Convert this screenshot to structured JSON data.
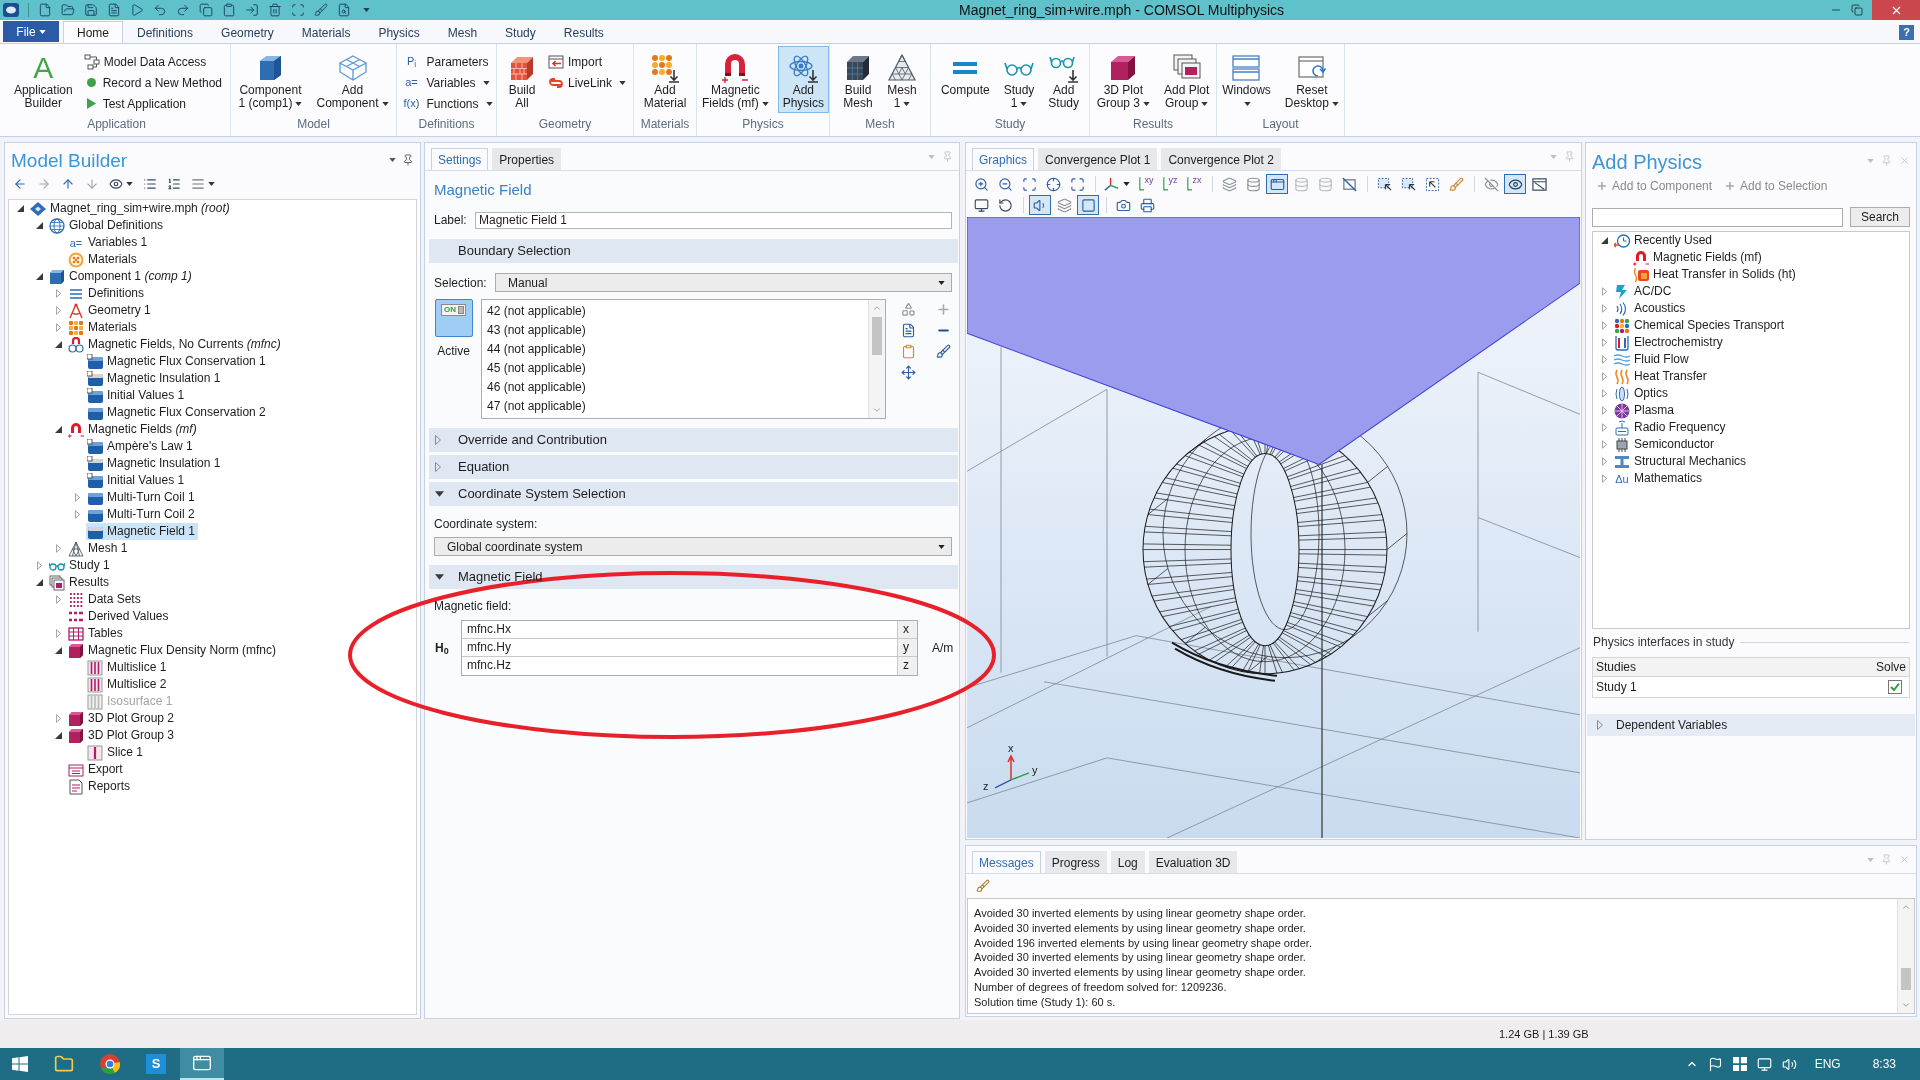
{
  "window": {
    "title": "Magnet_ring_sim+wire.mph - COMSOL Multiphysics"
  },
  "ribbon": {
    "file": "File",
    "help": "?",
    "tabs": [
      {
        "label": "Home",
        "selected": true
      },
      {
        "label": "Definitions",
        "selected": false
      },
      {
        "label": "Geometry",
        "selected": false
      },
      {
        "label": "Materials",
        "selected": false
      },
      {
        "label": "Physics",
        "selected": false
      },
      {
        "label": "Mesh",
        "selected": false
      },
      {
        "label": "Study",
        "selected": false
      },
      {
        "label": "Results",
        "selected": false
      }
    ],
    "groups": [
      {
        "title": "Application",
        "large": [
          {
            "kind": "builder",
            "glyph": "A",
            "lines": [
              "Application",
              "Builder"
            ],
            "dropdown": false,
            "on": false
          }
        ],
        "small": [
          {
            "kind": "data-access",
            "label": "Model Data Access",
            "dropdown": false
          },
          {
            "kind": "record",
            "label": "Record a New Method",
            "dropdown": false
          },
          {
            "kind": "run",
            "label": "Test Application",
            "dropdown": false
          }
        ]
      },
      {
        "title": "Model",
        "large": [
          {
            "kind": "component",
            "lines": [
              "Component",
              "1 (comp1)"
            ],
            "dropdown": true,
            "on": false
          },
          {
            "kind": "add-component",
            "lines": [
              "Add",
              "Component"
            ],
            "dropdown": true,
            "on": false
          }
        ]
      },
      {
        "title": "Definitions",
        "small": [
          {
            "kind": "glyph",
            "glyph": "P$_{i}$",
            "label": "Parameters",
            "dropdown": false
          },
          {
            "kind": "glyph",
            "glyph": "a=",
            "label": "Variables",
            "dropdown": true
          },
          {
            "kind": "glyph",
            "glyph": "f(x)",
            "label": "Functions",
            "dropdown": true
          }
        ]
      },
      {
        "title": "Geometry",
        "large": [
          {
            "kind": "build-all",
            "lines": [
              "Build",
              "All"
            ],
            "dropdown": false,
            "on": false
          }
        ],
        "small": [
          {
            "kind": "import",
            "label": "Import",
            "dropdown": false
          },
          {
            "kind": "livelink",
            "label": "LiveLink",
            "dropdown": true
          }
        ]
      },
      {
        "title": "Materials",
        "large": [
          {
            "kind": "add-material",
            "lines": [
              "Add",
              "Material"
            ],
            "dropdown": false,
            "on": false
          }
        ]
      },
      {
        "title": "Physics",
        "large": [
          {
            "kind": "magnet",
            "lines": [
              "Magnetic",
              "Fields (mf)"
            ],
            "dropdown": true,
            "on": false
          },
          {
            "kind": "add-physics",
            "lines": [
              "Add",
              "Physics"
            ],
            "dropdown": false,
            "on": true
          }
        ]
      },
      {
        "title": "Mesh",
        "large": [
          {
            "kind": "build-mesh",
            "lines": [
              "Build",
              "Mesh"
            ],
            "dropdown": false,
            "on": false
          },
          {
            "kind": "mesh",
            "lines": [
              "Mesh",
              "1"
            ],
            "dropdown": true,
            "on": false
          }
        ]
      },
      {
        "title": "Study",
        "large": [
          {
            "kind": "compute",
            "lines": [
              "Compute"
            ],
            "dropdown": false,
            "on": false
          },
          {
            "kind": "study",
            "lines": [
              "Study",
              "1"
            ],
            "dropdown": true,
            "on": false
          },
          {
            "kind": "add-study",
            "lines": [
              "Add",
              "Study"
            ],
            "dropdown": false,
            "on": false
          }
        ]
      },
      {
        "title": "Results",
        "large": [
          {
            "kind": "plot-group",
            "lines": [
              "3D Plot",
              "Group 3"
            ],
            "dropdown": true,
            "on": false
          },
          {
            "kind": "add-plot",
            "lines": [
              "Add Plot",
              "Group"
            ],
            "dropdown": true,
            "on": false
          }
        ]
      },
      {
        "title": "Layout",
        "large": [
          {
            "kind": "windows",
            "lines": [
              "Windows"
            ],
            "dropdown": true,
            "on": false
          },
          {
            "kind": "reset",
            "lines": [
              "Reset",
              "Desktop"
            ],
            "dropdown": true,
            "on": false
          }
        ]
      }
    ]
  },
  "model_builder": {
    "title": "Model Builder",
    "tree": [
      {
        "label": "Magnet_ring_sim+wire.mph *(root)*",
        "kind": "file",
        "expanded": true,
        "selected": false,
        "disabled": false,
        "children": [
          {
            "label": "Global Definitions",
            "kind": "globe",
            "expanded": true,
            "selected": false,
            "disabled": false,
            "children": [
              {
                "label": "Variables 1",
                "kind": "variables",
                "glyph": "a=",
                "selected": false,
                "disabled": false
              },
              {
                "label": "Materials",
                "kind": "materials-global",
                "selected": false,
                "disabled": false
              }
            ]
          },
          {
            "label": "Component 1 *(comp 1)*",
            "kind": "component",
            "expanded": true,
            "selected": false,
            "disabled": false,
            "children": [
              {
                "label": "Definitions",
                "kind": "definitions",
                "expanded": false,
                "selected": false,
                "disabled": false
              },
              {
                "label": "Geometry 1",
                "kind": "geometry",
                "expanded": false,
                "selected": false,
                "disabled": false
              },
              {
                "label": "Materials",
                "kind": "materials",
                "expanded": false,
                "selected": false,
                "disabled": false
              },
              {
                "label": "Magnetic Fields, No Currents *(mfnc)*",
                "kind": "mfnc",
                "expanded": true,
                "selected": false,
                "disabled": false,
                "children": [
                  {
                    "label": "Magnetic Flux Conservation 1",
                    "kind": "domain-default",
                    "selected": false,
                    "disabled": false
                  },
                  {
                    "label": "Magnetic Insulation 1",
                    "kind": "boundary-default",
                    "selected": false,
                    "disabled": false
                  },
                  {
                    "label": "Initial Values 1",
                    "kind": "domain-default",
                    "selected": false,
                    "disabled": false
                  },
                  {
                    "label": "Magnetic Flux Conservation 2",
                    "kind": "domain",
                    "selected": false,
                    "disabled": false
                  }
                ]
              },
              {
                "label": "Magnetic Fields *(mf)*",
                "kind": "magnet",
                "expanded": true,
                "selected": false,
                "disabled": false,
                "children": [
                  {
                    "label": "Ampère's Law 1",
                    "kind": "domain-default",
                    "selected": false,
                    "disabled": false
                  },
                  {
                    "label": "Magnetic Insulation 1",
                    "kind": "boundary-default",
                    "selected": false,
                    "disabled": false
                  },
                  {
                    "label": "Initial Values 1",
                    "kind": "domain-default",
                    "selected": false,
                    "disabled": false
                  },
                  {
                    "label": "Multi-Turn Coil 1",
                    "kind": "domain",
                    "expanded": false,
                    "selected": false,
                    "disabled": false
                  },
                  {
                    "label": "Multi-Turn Coil 2",
                    "kind": "domain",
                    "expanded": false,
                    "selected": false,
                    "disabled": false
                  },
                  {
                    "label": "Magnetic Field 1",
                    "kind": "boundary",
                    "selected": true,
                    "disabled": false
                  }
                ]
              },
              {
                "label": "Mesh 1",
                "kind": "mesh",
                "expanded": false,
                "selected": false,
                "disabled": false
              }
            ]
          },
          {
            "label": "Study 1",
            "kind": "study",
            "expanded": false,
            "selected": false,
            "disabled": false
          },
          {
            "label": "Results",
            "kind": "results",
            "expanded": true,
            "selected": false,
            "disabled": false,
            "children": [
              {
                "label": "Data Sets",
                "kind": "datasets",
                "expanded": false,
                "selected": false,
                "disabled": false
              },
              {
                "label": "Derived Values",
                "kind": "derived",
                "selected": false,
                "disabled": false
              },
              {
                "label": "Tables",
                "kind": "table",
                "expanded": false,
                "selected": false,
                "disabled": false
              },
              {
                "label": "Magnetic Flux Density Norm (mfnc)",
                "kind": "plotgroup",
                "expanded": true,
                "selected": false,
                "disabled": false,
                "children": [
                  {
                    "label": "Multislice 1",
                    "kind": "multislice",
                    "selected": false,
                    "disabled": false
                  },
                  {
                    "label": "Multislice 2",
                    "kind": "multislice",
                    "selected": false,
                    "disabled": false
                  },
                  {
                    "label": "Isosurface 1",
                    "kind": "multislice",
                    "selected": false,
                    "disabled": true
                  }
                ]
              },
              {
                "label": "3D Plot Group 2",
                "kind": "plotgroup",
                "expanded": false,
                "selected": false,
                "disabled": false
              },
              {
                "label": "3D Plot Group 3",
                "kind": "plotgroup",
                "expanded": true,
                "selected": false,
                "disabled": false,
                "children": [
                  {
                    "label": "Slice 1",
                    "kind": "slice",
                    "selected": false,
                    "disabled": false
                  }
                ]
              },
              {
                "label": "Export",
                "kind": "export",
                "selected": false,
                "disabled": false
              },
              {
                "label": "Reports",
                "kind": "reports",
                "selected": false,
                "disabled": false
              }
            ]
          }
        ]
      }
    ]
  },
  "settings": {
    "tabs": [
      {
        "label": "Settings",
        "selected": true
      },
      {
        "label": "Properties",
        "selected": false
      }
    ],
    "title": "Magnetic Field",
    "label": {
      "caption": "Label:",
      "value": "Magnetic Field 1"
    },
    "sections": [
      {
        "kind": "selection",
        "title": "Boundary Selection",
        "caption": "Selection:",
        "value": "Manual",
        "switch": "ON",
        "active_caption": "Active",
        "active": true,
        "items": [
          "42 (not applicable)",
          "43 (not applicable)",
          "44 (not applicable)",
          "45 (not applicable)",
          "46 (not applicable)",
          "47 (not applicable)"
        ]
      },
      {
        "title": "Override and Contribution",
        "expanded": false
      },
      {
        "title": "Equation",
        "expanded": false
      },
      {
        "kind": "coordinate",
        "title": "Coordinate System Selection",
        "expanded": true,
        "caption": "Coordinate system:",
        "value": "Global coordinate system"
      },
      {
        "kind": "vector",
        "title": "Magnetic Field",
        "expanded": true,
        "caption": "Magnetic field:",
        "symbol": "H$_{0}$",
        "unit": "A/m",
        "components": [
          {
            "value": "mfnc.Hx",
            "axis": "x"
          },
          {
            "value": "mfnc.Hy",
            "axis": "y"
          },
          {
            "value": "mfnc.Hz",
            "axis": "z"
          }
        ]
      }
    ]
  },
  "graphics": {
    "tabs": [
      {
        "label": "Graphics",
        "selected": true
      },
      {
        "label": "Convergence Plot 1",
        "selected": false
      },
      {
        "label": "Convergence Plot 2",
        "selected": false
      }
    ],
    "toolbar": [
      [
        {
          "kind": "zoom-in",
          "on": false
        },
        {
          "kind": "zoom-out",
          "on": false
        },
        {
          "kind": "zoom-box",
          "on": false
        },
        {
          "kind": "zoom-selected",
          "on": false
        },
        {
          "kind": "zoom-extents",
          "on": false
        },
        {
          "kind": "separator"
        },
        {
          "kind": "axes",
          "on": false
        },
        {
          "kind": "view",
          "glyph": "xy",
          "on": false
        },
        {
          "kind": "view",
          "glyph": "yz",
          "on": false
        },
        {
          "kind": "view",
          "glyph": "zx",
          "on": false
        },
        {
          "kind": "separator"
        },
        {
          "kind": "layers",
          "on": false
        },
        {
          "kind": "cylinder",
          "on": false
        },
        {
          "kind": "panel",
          "on": true
        },
        {
          "kind": "cylinder-outline",
          "on": false
        },
        {
          "kind": "cylinder-outline",
          "on": false
        },
        {
          "kind": "hide-box",
          "on": false
        },
        {
          "kind": "separator"
        },
        {
          "kind": "select",
          "on": false
        },
        {
          "kind": "select",
          "on": false
        },
        {
          "kind": "select-dashed",
          "on": false
        },
        {
          "kind": "brush",
          "on": false
        },
        {
          "kind": "separator"
        },
        {
          "kind": "eye-off",
          "on": false
        },
        {
          "kind": "eye",
          "on": true
        },
        {
          "kind": "panel-crossed",
          "on": false
        }
      ],
      [
        {
          "kind": "scene",
          "on": false
        },
        {
          "kind": "reset",
          "on": false
        },
        {
          "kind": "separator"
        },
        {
          "kind": "light",
          "on": true
        },
        {
          "kind": "layers",
          "on": false
        },
        {
          "kind": "frame",
          "on": true
        },
        {
          "kind": "separator"
        },
        {
          "kind": "camera",
          "on": false
        },
        {
          "kind": "printer",
          "on": false
        }
      ]
    ],
    "axes": [
      "x",
      "y",
      "z"
    ]
  },
  "add_physics": {
    "title": "Add Physics",
    "actions": [
      {
        "label": "Add to Component",
        "disabled": true
      },
      {
        "label": "Add to Selection",
        "disabled": true
      }
    ],
    "search_button": "Search",
    "tree": [
      {
        "label": "Recently Used",
        "kind": "recent",
        "expanded": true,
        "children": [
          {
            "label": "Magnetic Fields (mf)",
            "kind": "magnet"
          },
          {
            "label": "Heat Transfer in Solids (ht)",
            "kind": "heat-solid"
          }
        ]
      },
      {
        "label": "AC/DC",
        "kind": "acdc",
        "expanded": false
      },
      {
        "label": "Acoustics",
        "kind": "acoustics",
        "expanded": false
      },
      {
        "label": "Chemical Species Transport",
        "kind": "chemical",
        "expanded": false
      },
      {
        "label": "Electrochemistry",
        "kind": "electrochemistry",
        "expanded": false
      },
      {
        "label": "Fluid Flow",
        "kind": "fluid",
        "expanded": false
      },
      {
        "label": "Heat Transfer",
        "kind": "heat",
        "expanded": false
      },
      {
        "label": "Optics",
        "kind": "optics",
        "expanded": false
      },
      {
        "label": "Plasma",
        "kind": "plasma",
        "expanded": false
      },
      {
        "label": "Radio Frequency",
        "kind": "radio",
        "expanded": false
      },
      {
        "label": "Semiconductor",
        "kind": "semiconductor",
        "expanded": false
      },
      {
        "label": "Structural Mechanics",
        "kind": "structural",
        "expanded": false
      },
      {
        "label": "Mathematics",
        "kind": "math",
        "glyph": "Δu",
        "expanded": false
      }
    ],
    "interfaces_title": "Physics interfaces in study",
    "table": {
      "columns": [
        "Studies",
        "Solve"
      ],
      "rows": [
        {
          "study": "Study 1",
          "solve": true
        }
      ]
    },
    "dependent_variables": {
      "title": "Dependent Variables",
      "expanded": false
    }
  },
  "messages": {
    "tabs": [
      {
        "label": "Messages",
        "selected": true
      },
      {
        "label": "Progress",
        "selected": false
      },
      {
        "label": "Log",
        "selected": false
      },
      {
        "label": "Evaluation 3D",
        "selected": false
      }
    ],
    "lines": [
      "Avoided 30 inverted elements by using linear geometry shape order.",
      "Avoided 30 inverted elements by using linear geometry shape order.",
      "Avoided 196 inverted elements by using linear geometry shape order.",
      "Avoided 30 inverted elements by using linear geometry shape order.",
      "Avoided 30 inverted elements by using linear geometry shape order.",
      "Number of degrees of freedom solved for: 1209236.",
      "Solution time (Study 1): 60 s."
    ]
  },
  "status_bar": {
    "memory": "1.24 GB | 1.39 GB"
  },
  "taskbar": {
    "apps": [
      {
        "kind": "folder",
        "active": false
      },
      {
        "kind": "browser",
        "active": false
      },
      {
        "kind": "letter",
        "glyph": "S",
        "active": false
      },
      {
        "kind": "window",
        "active": true
      }
    ],
    "language": "ENG",
    "time": "8:33"
  }
}
